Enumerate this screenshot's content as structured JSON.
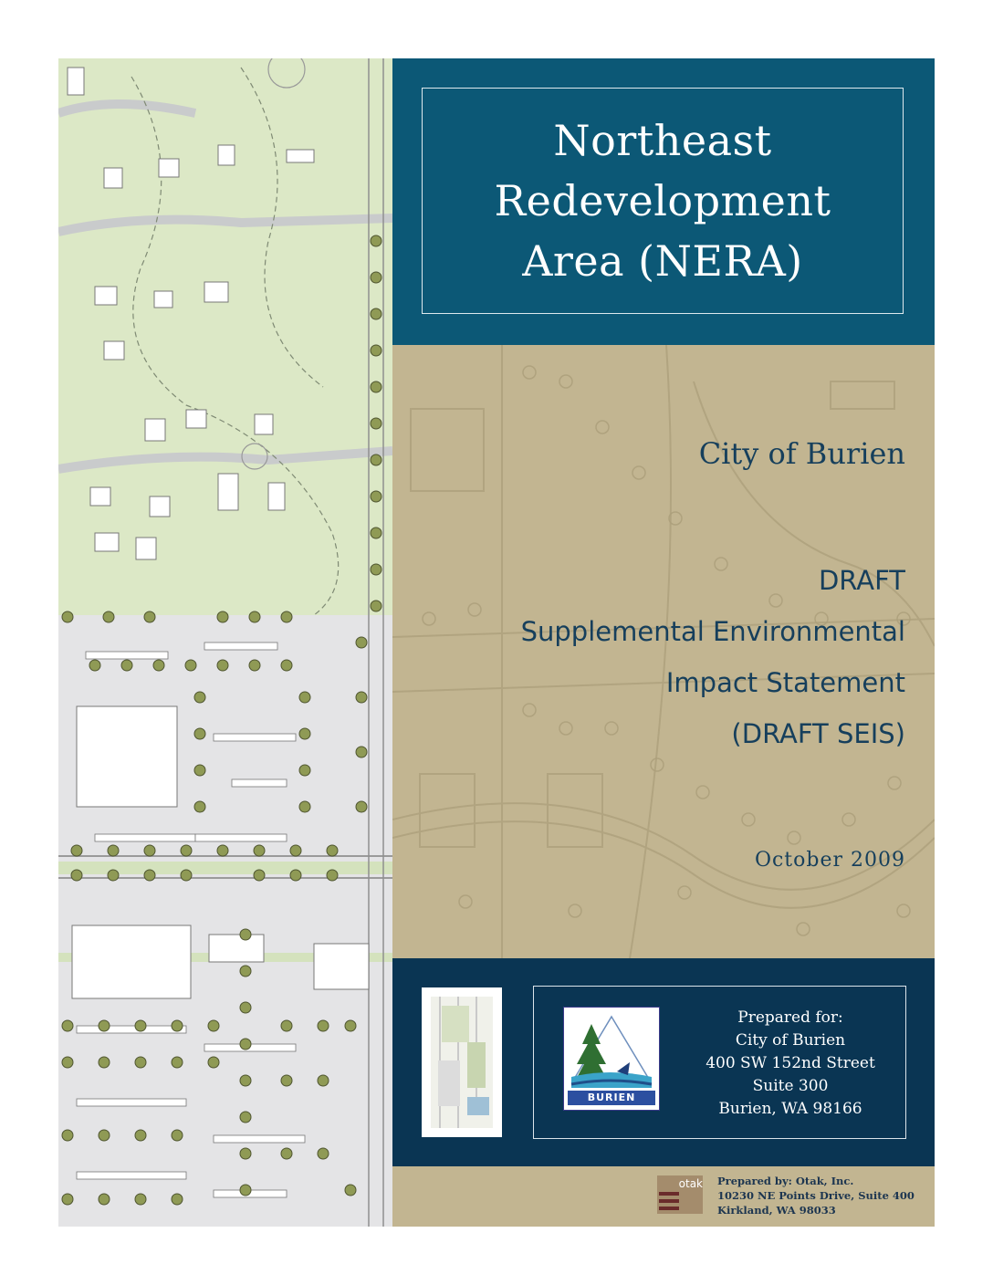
{
  "title": {
    "lines": [
      "Northeast",
      "Redevelopment",
      "Area (NERA)"
    ]
  },
  "client_name": "City of Burien",
  "document": {
    "lines": [
      "DRAFT",
      "Supplemental Environmental",
      "Impact Statement",
      "(DRAFT SEIS)"
    ]
  },
  "date": "October  2009",
  "prepared_for": {
    "heading": "Prepared for:",
    "lines": [
      "City of Burien",
      "400 SW 152nd Street",
      "Suite 300",
      "Burien, WA 98166"
    ]
  },
  "logo": {
    "text": "BURIEN",
    "icon": "burien-tree-mountain-logo"
  },
  "prepared_by": {
    "lines": [
      "Prepared by: Otak, Inc.",
      "10230 NE Points Drive, Suite 400",
      "Kirkland, WA 98033"
    ],
    "logo_text": "otak"
  },
  "colors": {
    "title_band": "#0c5876",
    "tan": "#c2b591",
    "bottom_band": "#0a3553",
    "text_dark_blue": "#163f5c",
    "plan_green": "#dce8c6",
    "plan_gray": "#e4e4e6",
    "tree": "#8f9a55"
  }
}
